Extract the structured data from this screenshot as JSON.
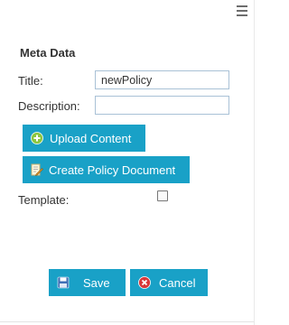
{
  "panel": {
    "section_title": "Meta Data",
    "title_label": "Title:",
    "title_value": "newPolicy",
    "description_label": "Description:",
    "description_value": "",
    "upload_label": "Upload Content",
    "create_label": "Create Policy Document",
    "template_label": "Template:",
    "template_checked": false
  },
  "footer": {
    "save_label": "Save",
    "cancel_label": "Cancel"
  },
  "icons": {
    "menu": "hamburger-menu-icon",
    "upload": "plus-circle-icon",
    "create": "document-edit-icon",
    "save": "floppy-disk-icon",
    "cancel": "x-circle-icon"
  },
  "colors": {
    "button_bg": "#19a1c7",
    "input_border": "#a9c1d6",
    "upload_icon": "#8cc63f",
    "cancel_icon": "#d9383a"
  }
}
